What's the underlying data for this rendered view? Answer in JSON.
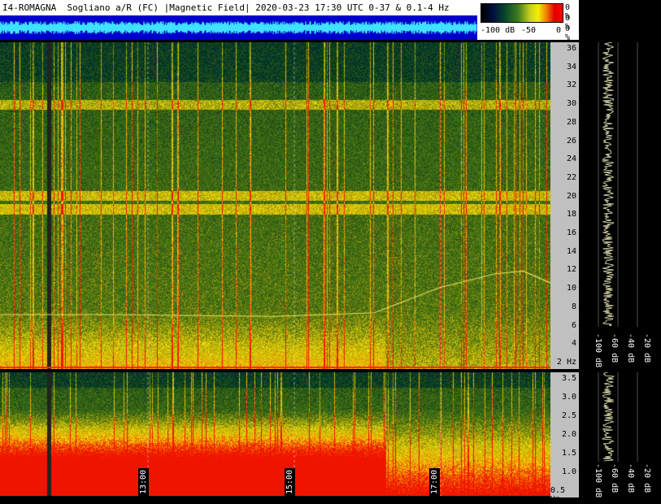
{
  "header": {
    "title": "I4-ROMAGNA  Sogliano a/R (FC) |Magnetic Field| 2020-03-23 17:30 UTC 0-37 & 0.1-4 Hz"
  },
  "colorbar": {
    "labels": [
      "-100 dB",
      "-50",
      "0"
    ],
    "percent_labels": [
      "0 %",
      "0 %",
      "0 %"
    ]
  },
  "chart_data": [
    {
      "type": "heatmap",
      "title": "",
      "panel": "upper",
      "ylabel": "",
      "y_ticks": [
        "36",
        "34",
        "32",
        "30",
        "28",
        "26",
        "24",
        "22",
        "20",
        "18",
        "16",
        "14",
        "12",
        "10",
        "8",
        "6",
        "4",
        "2 Hz"
      ],
      "ylim": [
        1,
        37
      ],
      "x_ticks": [],
      "features": [
        {
          "label": "",
          "y": [
            7.0,
            7.0,
            6.8,
            7.2,
            10.0,
            11.5,
            11.8,
            10.5
          ],
          "x": [
            0,
            0.2,
            0.5,
            0.68,
            0.8,
            0.9,
            0.95,
            1.0
          ]
        }
      ]
    },
    {
      "type": "heatmap",
      "title": "",
      "panel": "lower",
      "ylabel": "",
      "y_ticks": [
        "3.5",
        "3.0",
        "2.5",
        "2.0",
        "1.5",
        "1.0",
        "0.5 Hz"
      ],
      "ylim": [
        0.2,
        4
      ],
      "x_ticks": [
        "13:00",
        "15:00",
        "17:00"
      ]
    },
    {
      "type": "line",
      "title": "",
      "panel": "spectrum-upper",
      "x_ticks": [
        "-100 dB",
        "-60 dB",
        "-40 dB",
        "-20 dB"
      ]
    },
    {
      "type": "line",
      "title": "",
      "panel": "spectrum-lower",
      "x_ticks": [
        "-100 dB",
        "-60 dB",
        "-40 dB",
        "-20 dB"
      ]
    }
  ]
}
